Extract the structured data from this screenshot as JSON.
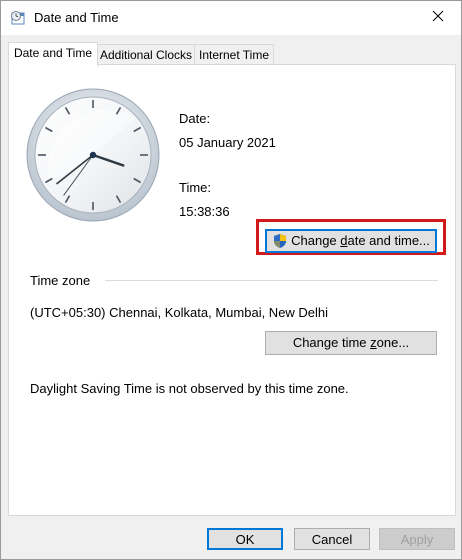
{
  "window": {
    "title": "Date and Time",
    "app_icon": "clock-calendar-icon"
  },
  "tabs": [
    {
      "label": "Date and Time",
      "active": true
    },
    {
      "label": "Additional Clocks",
      "active": false
    },
    {
      "label": "Internet Time",
      "active": false
    }
  ],
  "date": {
    "label": "Date:",
    "value": "05 January 2021"
  },
  "time": {
    "label": "Time:",
    "value": "15:38:36"
  },
  "clock": {
    "hours": 15,
    "minutes": 38,
    "seconds": 36
  },
  "change_datetime": {
    "prefix": "Change ",
    "underlined": "d",
    "suffix": "ate and time...",
    "icon": "uac-shield-icon"
  },
  "timezone": {
    "section_label": "Time zone",
    "value": "(UTC+05:30) Chennai, Kolkata, Mumbai, New Delhi",
    "button": {
      "prefix": "Change time ",
      "underlined": "z",
      "suffix": "one..."
    }
  },
  "dst_note": "Daylight Saving Time is not observed by this time zone.",
  "footer": {
    "ok": "OK",
    "cancel": "Cancel",
    "apply": "Apply"
  },
  "colors": {
    "highlight": "#d31a1a",
    "focus": "#0078d7"
  }
}
